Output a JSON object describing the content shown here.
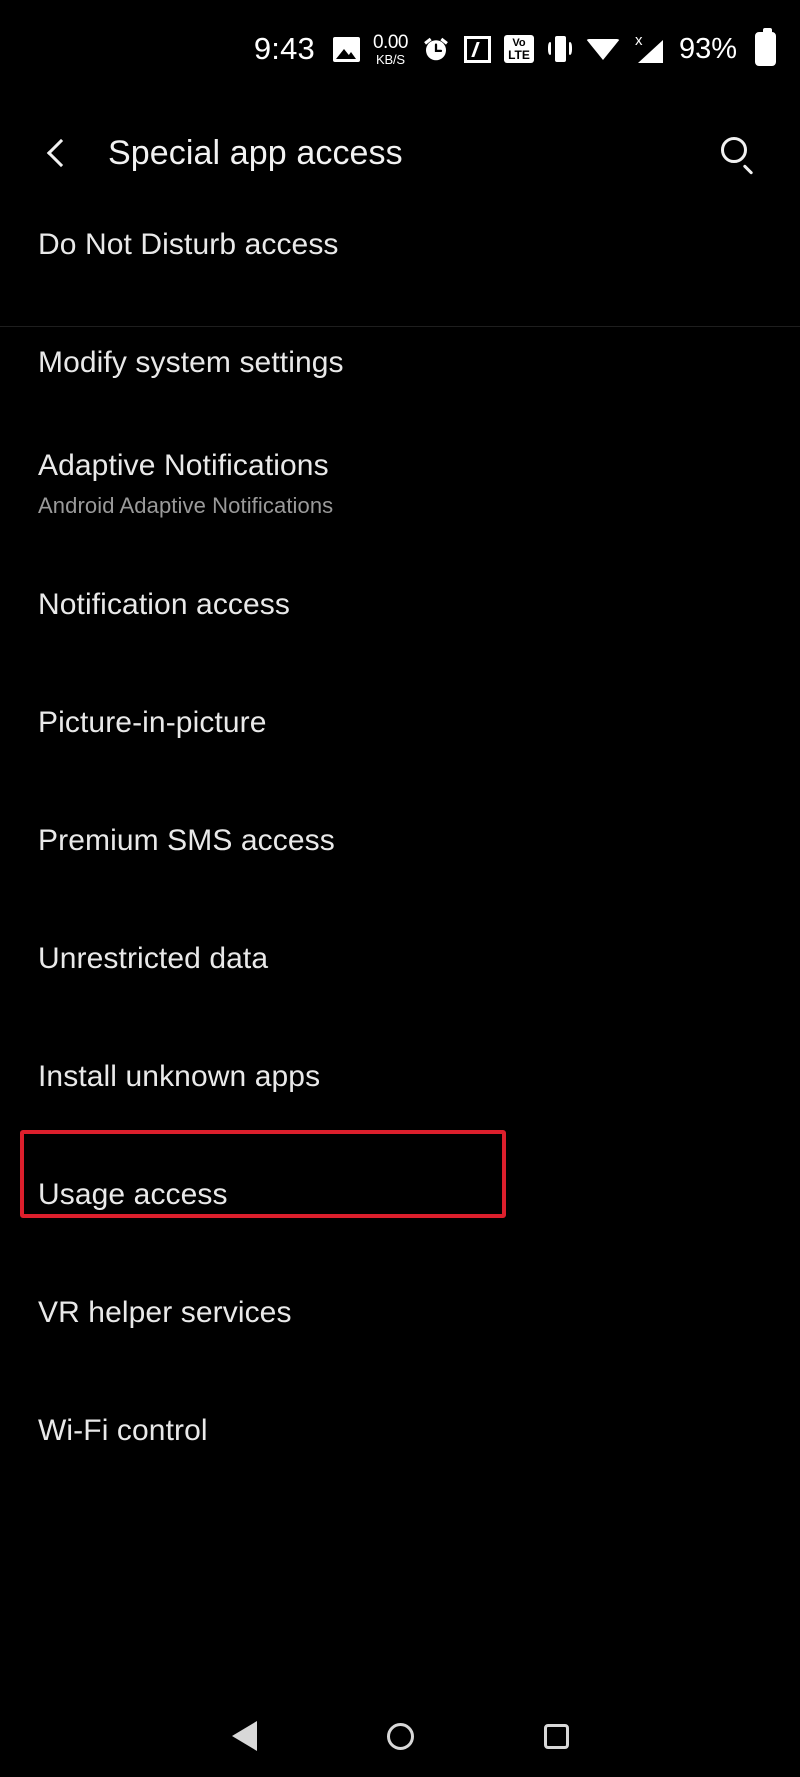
{
  "status_bar": {
    "time": "9:43",
    "icons": [
      {
        "name": "gallery-icon",
        "label": "image"
      },
      {
        "name": "network-speed-indicator",
        "value": "0.00",
        "unit": "KB/S"
      },
      {
        "name": "alarm-icon",
        "label": "alarm"
      },
      {
        "name": "nfc-icon",
        "label": "N"
      },
      {
        "name": "volte-icon",
        "label_top": "Vo",
        "label_bottom": "LTE"
      },
      {
        "name": "vibrate-icon",
        "label": "vibrate"
      },
      {
        "name": "wifi-icon",
        "label": "wifi"
      },
      {
        "name": "cellular-signal-icon",
        "label": "x"
      }
    ],
    "battery_percent": "93%",
    "battery_icon": "battery-icon"
  },
  "app_bar": {
    "back_icon": "back-chevron-icon",
    "title": "Special app access",
    "search_icon": "search-icon"
  },
  "list": {
    "items": [
      {
        "title": "Do Not Disturb access",
        "subtitle": "",
        "highlighted": false,
        "partially_cut_off": true
      },
      {
        "title": "Modify system settings",
        "subtitle": "",
        "highlighted": false
      },
      {
        "title": "Adaptive Notifications",
        "subtitle": "Android Adaptive Notifications",
        "highlighted": false
      },
      {
        "title": "Notification access",
        "subtitle": "",
        "highlighted": false
      },
      {
        "title": "Picture-in-picture",
        "subtitle": "",
        "highlighted": false
      },
      {
        "title": "Premium SMS access",
        "subtitle": "",
        "highlighted": false
      },
      {
        "title": "Unrestricted data",
        "subtitle": "",
        "highlighted": false
      },
      {
        "title": "Install unknown apps",
        "subtitle": "",
        "highlighted": true
      },
      {
        "title": "Usage access",
        "subtitle": "",
        "highlighted": false
      },
      {
        "title": "VR helper services",
        "subtitle": "",
        "highlighted": false
      },
      {
        "title": "Wi-Fi control",
        "subtitle": "",
        "highlighted": false
      }
    ]
  },
  "highlight": {
    "color": "#dc1f2c",
    "target": "Install unknown apps"
  },
  "nav_bar": {
    "back": "back-triangle-icon",
    "home": "home-circle-icon",
    "recents": "recents-square-icon"
  },
  "colors": {
    "background": "#000000",
    "primary_text": "#e9e9e9",
    "secondary_text": "#9a9a9a",
    "accent_highlight": "#dc1f2c"
  }
}
